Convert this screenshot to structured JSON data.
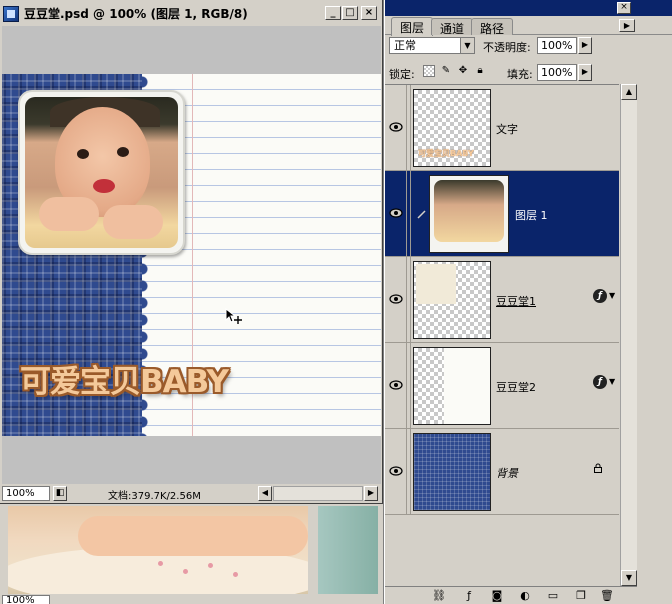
{
  "document": {
    "title": "豆豆堂.psd @ 100% (图层 1, RGB/8)",
    "artwork_text": "可爱宝贝BABY",
    "status": {
      "zoom": "100%",
      "info": "文档:379.7K/2.56M"
    }
  },
  "background_document": {
    "zoom": "100%"
  },
  "layers_panel": {
    "tabs": [
      {
        "label": "图层",
        "active": true
      },
      {
        "label": "通道",
        "active": false
      },
      {
        "label": "路径",
        "active": false
      }
    ],
    "blend_mode": "正常",
    "opacity_label": "不透明度:",
    "opacity_value": "100%",
    "lock_label": "锁定:",
    "fill_label": "填充:",
    "fill_value": "100%",
    "layers": [
      {
        "name": "文字",
        "visible": true,
        "selected": false,
        "has_effects": false,
        "thumb_text": "可爱宝贝BABY"
      },
      {
        "name": "图层 1",
        "visible": true,
        "selected": true,
        "has_effects": false
      },
      {
        "name": "豆豆堂1",
        "visible": true,
        "selected": false,
        "has_effects": true
      },
      {
        "name": "豆豆堂2",
        "visible": true,
        "selected": false,
        "has_effects": true
      },
      {
        "name": "背景",
        "visible": true,
        "selected": false,
        "locked": true
      }
    ],
    "toolbar_icons": [
      "link-icon",
      "fx-icon",
      "mask-icon",
      "adjustment-layer-icon",
      "new-group-icon",
      "new-layer-icon",
      "trash-icon"
    ]
  },
  "colors": {
    "title_bar": "#0a246a",
    "selected_row": "#0a246a",
    "pattern_blue": "#2f4a8f",
    "text_fill": "#f4c99a",
    "text_outline": "#9a5a2a"
  }
}
